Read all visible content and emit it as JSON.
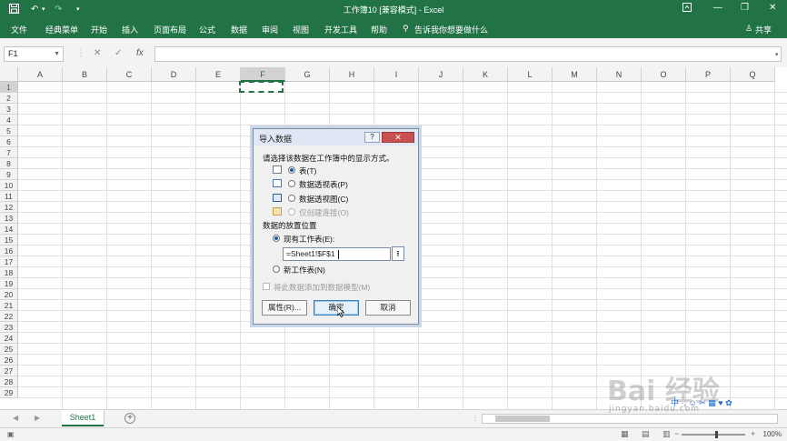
{
  "titlebar": {
    "title": "工作簿10 [兼容模式] - Excel",
    "save_icon": "save-icon",
    "undo_icon": "undo-icon",
    "redo_icon": "redo-icon",
    "window_controls": [
      "minimize-icon",
      "restore-icon",
      "close-icon"
    ],
    "ribbon_options_icon": "ribbon-display-icon"
  },
  "menubar": {
    "items": [
      "文件",
      "经典菜单",
      "开始",
      "插入",
      "页面布局",
      "公式",
      "数据",
      "审阅",
      "视图",
      "开发工具",
      "帮助"
    ],
    "tell_me": "告诉我你想要做什么",
    "share": "共享"
  },
  "formulabar": {
    "namebox": "F1",
    "cancel_glyph": "✕",
    "enter_glyph": "✓",
    "fx_label": "fx",
    "formula": ""
  },
  "grid": {
    "columns": [
      "A",
      "B",
      "C",
      "D",
      "E",
      "F",
      "G",
      "H",
      "I",
      "J",
      "K",
      "L",
      "M",
      "N",
      "O",
      "P",
      "Q"
    ],
    "selected_column": "F",
    "rows": [
      "1",
      "2",
      "3",
      "4",
      "5",
      "6",
      "7",
      "8",
      "9",
      "10",
      "11",
      "12",
      "13",
      "14",
      "15",
      "16",
      "17",
      "18",
      "19",
      "20",
      "21",
      "22",
      "23",
      "24",
      "25",
      "26",
      "27",
      "28",
      "29"
    ],
    "selected_row": "1"
  },
  "dialog": {
    "title": "导入数据",
    "help_label": "?",
    "close_label": "✕",
    "prompt": "请选择该数据在工作簿中的显示方式。",
    "view_options": [
      {
        "label": "表(T)",
        "icon": "table-icon",
        "selected": true,
        "enabled": true
      },
      {
        "label": "数据透视表(P)",
        "icon": "pivot-table-icon",
        "selected": false,
        "enabled": true
      },
      {
        "label": "数据透视图(C)",
        "icon": "pivot-chart-icon",
        "selected": false,
        "enabled": true
      },
      {
        "label": "仅创建连接(O)",
        "icon": "connection-icon",
        "selected": false,
        "enabled": false
      }
    ],
    "location_heading": "数据的放置位置",
    "existing_sheet_label": "现有工作表(E):",
    "range_value": "=Sheet1!$F$1",
    "new_sheet_label": "新工作表(N)",
    "add_to_model_label": "将此数据添加到数据模型(M)",
    "properties_button": "属性(R)...",
    "ok_button": "确定",
    "cancel_button": "取消"
  },
  "tabbar": {
    "sheet_name": "Sheet1",
    "add_glyph": "+"
  },
  "statusbar": {
    "zoom": "100%"
  },
  "watermark": {
    "text": "Bai 经验",
    "url": "jingyan.baidu.com",
    "ime": "中 ·, ☺ ✂ ▦ ♥ ✿"
  }
}
